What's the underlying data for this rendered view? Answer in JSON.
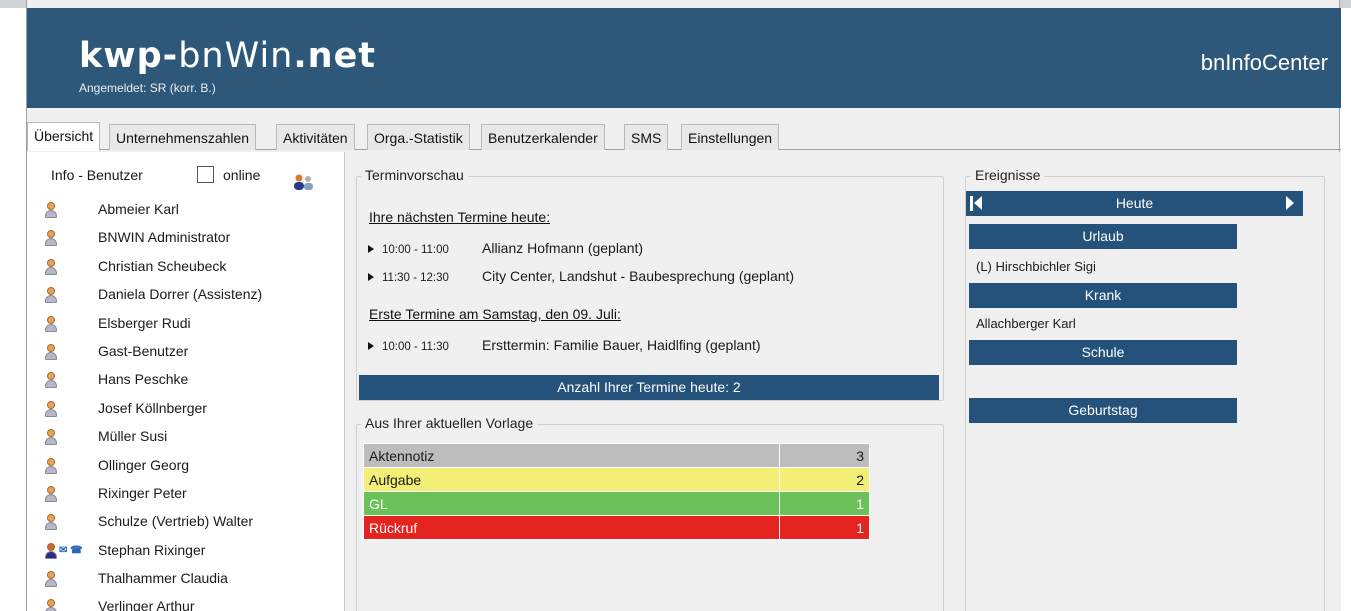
{
  "header": {
    "logo_bold": "kwp-",
    "logo_light": "bnWin",
    "logo_suffix": ".net",
    "login_text": "Angemeldet: SR (korr. B.)",
    "app_name": "bnInfoCenter",
    "bg_color": "#2d5879"
  },
  "tabs": [
    {
      "label": "Übersicht",
      "active": true
    },
    {
      "label": "Unternehmenszahlen"
    },
    {
      "label": "Aktivitäten"
    },
    {
      "label": "Orga.-Statistik"
    },
    {
      "label": "Benutzerkalender"
    },
    {
      "label": "SMS"
    },
    {
      "label": "Einstellungen"
    }
  ],
  "users": {
    "title": "Info - Benutzer",
    "online_label": "online",
    "online_checked": false,
    "list": [
      {
        "name": "Abmeier Karl"
      },
      {
        "name": "BNWIN Administrator"
      },
      {
        "name": "Christian Scheubeck"
      },
      {
        "name": "Daniela Dorrer (Assistenz)"
      },
      {
        "name": "Elsberger Rudi"
      },
      {
        "name": "Gast-Benutzer"
      },
      {
        "name": "Hans Peschke"
      },
      {
        "name": "Josef Köllnberger"
      },
      {
        "name": "Müller Susi"
      },
      {
        "name": "Ollinger Georg"
      },
      {
        "name": "Rixinger Peter"
      },
      {
        "name": "Schulze (Vertrieb) Walter"
      },
      {
        "name": "Stephan Rixinger",
        "active": true
      },
      {
        "name": "Thalhammer Claudia"
      },
      {
        "name": "Verlinger Arthur"
      }
    ]
  },
  "termine": {
    "title": "Terminvorschau",
    "today_heading": "Ihre nächsten Termine heute:",
    "today": [
      {
        "time": "10:00 - 11:00",
        "text": "Allianz Hofmann (geplant)"
      },
      {
        "time": "11:30 - 12:30",
        "text": "City Center, Landshut - Baubesprechung (geplant)"
      }
    ],
    "next_heading": "Erste Termine am Samstag, den 09. Juli:",
    "next": [
      {
        "time": "10:00 - 11:30",
        "text": "Ersttermin: Familie Bauer, Haidlfing (geplant)"
      }
    ],
    "count_text": "Anzahl Ihrer Termine heute: 2"
  },
  "vorlage": {
    "title": "Aus Ihrer aktuellen Vorlage",
    "rows": [
      {
        "label": "Aktennotiz",
        "count": "3",
        "color": "#bdbdbd",
        "text_color": "#1a1a1a"
      },
      {
        "label": "Aufgabe",
        "count": "2",
        "color": "#f2ee76",
        "text_color": "#1a1a1a"
      },
      {
        "label": "GL",
        "count": "1",
        "color": "#6cc25a",
        "text_color": "#ffffff"
      },
      {
        "label": "Rückruf",
        "count": "1",
        "color": "#e5231f",
        "text_color": "#ffffff"
      }
    ]
  },
  "ereignisse": {
    "title": "Ereignisse",
    "current": "Heute",
    "categories": [
      {
        "label": "Urlaub",
        "entries": [
          "(L) Hirschbichler Sigi"
        ]
      },
      {
        "label": "Krank",
        "entries": [
          "Allachberger Karl"
        ]
      },
      {
        "label": "Schule",
        "entries": []
      },
      {
        "label": "Geburtstag",
        "entries": []
      }
    ]
  }
}
